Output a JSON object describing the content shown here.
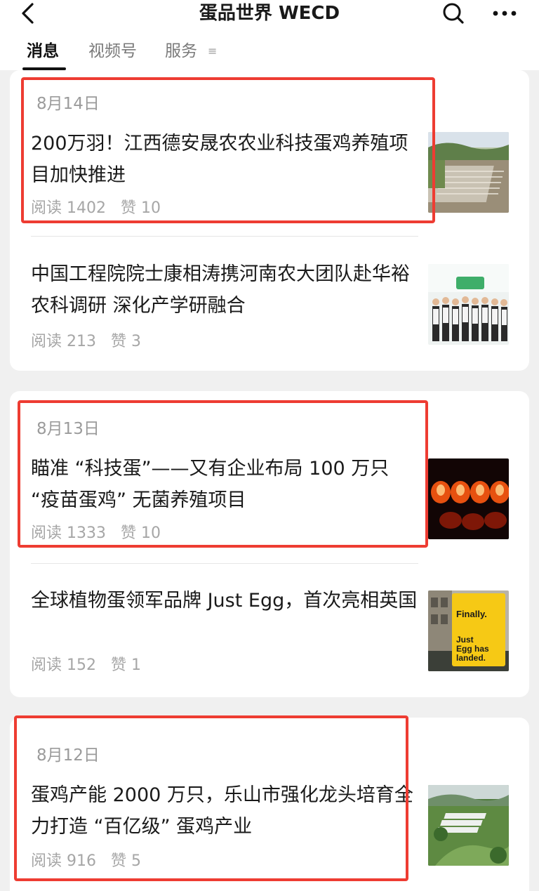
{
  "header": {
    "title": "蛋品世界 WECD",
    "back_icon": "chevron-left-icon",
    "search_icon": "search-icon",
    "more_icon": "more-horizontal-icon"
  },
  "tabs": [
    {
      "label": "消息",
      "active": true
    },
    {
      "label": "视频号",
      "active": false
    },
    {
      "label": "服务",
      "active": false
    }
  ],
  "tab_menu_icon": "≡",
  "colors": {
    "highlight": "#ee3c32",
    "background": "#f0f0f0"
  },
  "groups": [
    {
      "date": "8月14日",
      "articles": [
        {
          "title": "200万羽！江西德安晟农农业科技蛋鸡养殖项目加快推进",
          "reads": "阅读 1402",
          "likes": "赞 10",
          "thumb": "aerial-farm-construction"
        },
        {
          "title": "中国工程院院士康相涛携河南农大团队赴华裕农科调研 深化产学研融合",
          "reads": "阅读 213",
          "likes": "赞 3",
          "thumb": "group-photo"
        }
      ]
    },
    {
      "date": "8月13日",
      "articles": [
        {
          "title": "瞄准 “科技蛋”——又有企业布局 100 万只 “疫苗蛋鸡” 无菌养殖项目",
          "reads": "阅读 1333",
          "likes": "赞 10",
          "thumb": "glowing-eggs"
        },
        {
          "title": "全球植物蛋领军品牌 Just Egg，首次亮相英国",
          "reads": "阅读 152",
          "likes": "赞 1",
          "thumb": "just-egg-billboard",
          "thumb_text": "Finally. Just Egg has landed."
        }
      ]
    },
    {
      "date": "8月12日",
      "articles": [
        {
          "title": "蛋鸡产能 2000 万只，乐山市强化龙头培育全力打造 “百亿级” 蛋鸡产业",
          "reads": "阅读 916",
          "likes": "赞 5",
          "thumb": "aerial-farm-hills"
        }
      ]
    }
  ]
}
